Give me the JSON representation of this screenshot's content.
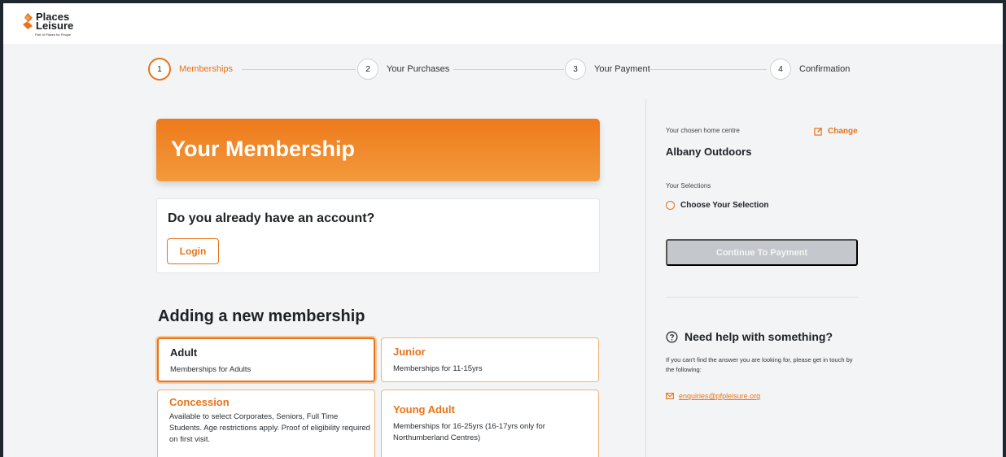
{
  "brand": {
    "name_line1": "Places",
    "name_line2": "Leisure",
    "tagline": "Part of Places for People"
  },
  "stepper": {
    "steps": [
      {
        "number": "1",
        "label": "Memberships",
        "active": true
      },
      {
        "number": "2",
        "label": "Your Purchases",
        "active": false
      },
      {
        "number": "3",
        "label": "Your Payment",
        "active": false
      },
      {
        "number": "4",
        "label": "Confirmation",
        "active": false
      }
    ]
  },
  "hero": {
    "title": "Your Membership"
  },
  "account": {
    "question": "Do you already have an account?",
    "login_label": "Login"
  },
  "memberships": {
    "section_title": "Adding a new membership",
    "options": [
      {
        "title": "Adult",
        "description": "Memberships for Adults",
        "selected": true
      },
      {
        "title": "Junior",
        "description": "Memberships for 11-15yrs",
        "selected": false
      },
      {
        "title": "Concession",
        "description": "Available to select Corporates, Seniors, Full Time Students. Age restrictions apply. Proof of eligibility required on first visit.",
        "selected": false
      },
      {
        "title": "Young Adult",
        "description": "Memberships for 16-25yrs (16-17yrs only for Northumberland Centres)",
        "selected": false
      }
    ]
  },
  "sidebar": {
    "home_centre_label": "Your chosen home centre",
    "change_label": "Change",
    "centre_name": "Albany Outdoors",
    "selections_label": "Your Selections",
    "selection_placeholder": "Choose Your Selection",
    "continue_label": "Continue To Payment",
    "help_title": "Need help with something?",
    "help_text": "If you can't find the answer you are looking for, please get in touch by the following:",
    "email": "enquiries@pfpleisure.org"
  },
  "colors": {
    "accent": "#e8731a",
    "disabled_button": "#c4c7cb",
    "page_background": "#f3f4f5"
  }
}
